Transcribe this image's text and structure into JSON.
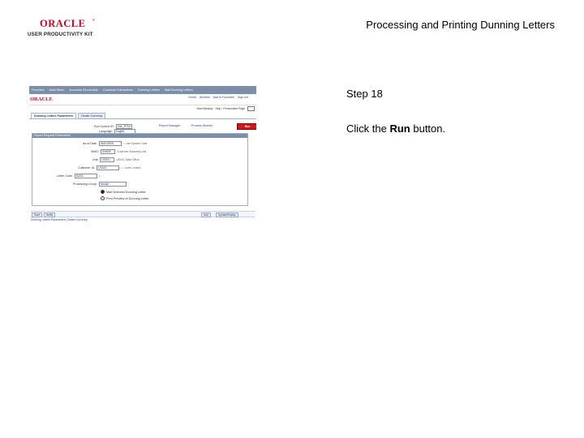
{
  "header": {
    "logo_wordmark": "ORACLE",
    "logo_registered": "®",
    "logo_subtitle": "USER PRODUCTIVITY KIT",
    "doc_title": "Processing and Printing Dunning Letters"
  },
  "step": {
    "label": "Step 18",
    "instruction_prefix": "Click the ",
    "instruction_target": "Run",
    "instruction_suffix": " button."
  },
  "screenshot": {
    "menubar": [
      "Favorites",
      "Main Menu",
      "Accounts Receivable",
      "Customer Interactions",
      "Dunning Letters",
      "Mail Dunning Letters"
    ],
    "app_logo": "ORACLE",
    "toplinks": [
      "Home",
      "Worklist",
      "Add to Favorites",
      "Sign out"
    ],
    "subtoolbar": [
      "New Window",
      "Help",
      "Personalize Page"
    ],
    "tabs": [
      {
        "label": "Dunning Letters Parameters",
        "active": true
      },
      {
        "label": "Dealer Currency",
        "active": false
      }
    ],
    "run_control_label": "Run Control ID:",
    "run_control_value": "UNL_RTN1",
    "report_manager": "Report Manager",
    "process_monitor": "Process Monitor",
    "run_button": "Run",
    "language_label": "Language:",
    "language_value": "English",
    "panel_title": "Report Request Parameters",
    "fields": [
      {
        "label": "As of Date:",
        "value": "04/01/2009",
        "desc": "Use System Date"
      },
      {
        "label": "SetID:",
        "value": "SHARE",
        "desc": "Customer Business Unit"
      },
      {
        "label": "Unit:",
        "value": "US001",
        "desc": "US001 Main Office"
      },
      {
        "label": "Customer ID:",
        "value": "USA02",
        "desc": "Lowe Limited"
      },
      {
        "label": "Letter Code:",
        "value": "DUN3",
        "desc": ""
      },
      {
        "label": "Processing Group:",
        "value": "Include",
        "desc": ""
      }
    ],
    "radios": [
      {
        "label": "Mail Selected Dunning Letter",
        "selected": true
      },
      {
        "label": "Print Preview of Dunning Letter",
        "selected": false
      }
    ],
    "bottom_buttons_left": [
      "Save",
      "Notify"
    ],
    "bottom_buttons_right": [
      "Add",
      "Update/Display"
    ],
    "footer_links": "Dunning Letters Parameters | Dealer Currency"
  }
}
